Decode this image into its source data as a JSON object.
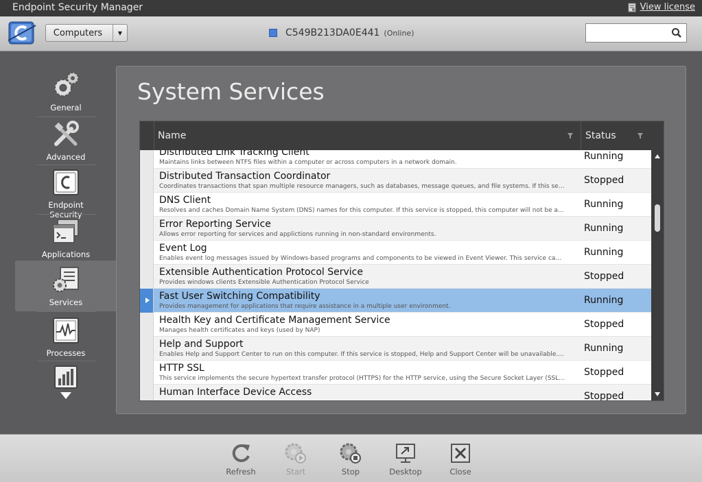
{
  "app": {
    "title": "Endpoint Security Manager",
    "license_link": "View license"
  },
  "toolbar": {
    "scope_dropdown": "Computers",
    "device_name": "C549B213DA0E441",
    "device_status": "(Online)",
    "search_placeholder": ""
  },
  "sidebar": {
    "items": [
      {
        "label": "General",
        "icon": "gears-icon"
      },
      {
        "label": "Advanced",
        "icon": "tools-icon"
      },
      {
        "label": "Endpoint Security",
        "icon": "endpoint-logo-icon"
      },
      {
        "label": "Applications",
        "icon": "applications-icon"
      },
      {
        "label": "Services",
        "icon": "services-icon",
        "selected": true
      },
      {
        "label": "Processes",
        "icon": "processes-icon"
      },
      {
        "label": "",
        "icon": "performance-icon"
      }
    ]
  },
  "main": {
    "title": "System Services",
    "columns": {
      "name": "Name",
      "status": "Status"
    },
    "rows": [
      {
        "name": "Distributed Link Tracking Client",
        "desc": "Maintains links between NTFS files within a computer or across computers in a network domain.",
        "status": "Running"
      },
      {
        "name": "Distributed Transaction Coordinator",
        "desc": "Coordinates transactions that span multiple resource managers, such as databases, message queues, and file systems. If this service is...",
        "status": "Stopped"
      },
      {
        "name": "DNS Client",
        "desc": "Resolves and caches Domain Name System (DNS) names for this computer. If this service is stopped, this computer will not be able to...",
        "status": "Running"
      },
      {
        "name": "Error Reporting Service",
        "desc": "Allows error reporting for services and applictions running in non-standard environments.",
        "status": "Running"
      },
      {
        "name": "Event Log",
        "desc": "Enables event log messages issued by Windows-based programs and components to be viewed in Event Viewer. This service cannot be...",
        "status": "Running"
      },
      {
        "name": "Extensible Authentication Protocol Service",
        "desc": "Provides windows clients Extensible Authentication Protocol Service",
        "status": "Stopped"
      },
      {
        "name": "Fast User Switching Compatibility",
        "desc": "Provides management for applications that require assistance in a multiple user environment.",
        "status": "Running",
        "selected": true
      },
      {
        "name": "Health Key and Certificate Management Service",
        "desc": "Manages health certificates and keys (used by NAP)",
        "status": "Stopped"
      },
      {
        "name": "Help and Support",
        "desc": "Enables Help and Support Center to run on this computer. If this service is stopped, Help and Support Center will be unavailable. If this...",
        "status": "Running"
      },
      {
        "name": "HTTP SSL",
        "desc": "This service implements the secure hypertext transfer protocol (HTTPS) for the HTTP service,  using the Secure Socket Layer (SSL). If this...",
        "status": "Stopped"
      },
      {
        "name": "Human Interface Device Access",
        "desc": "",
        "status": "Stopped"
      }
    ]
  },
  "actions": {
    "refresh": "Refresh",
    "start": "Start",
    "stop": "Stop",
    "desktop": "Desktop",
    "close": "Close"
  },
  "colors": {
    "selection": "#94bde7",
    "accent": "#4a8ad6",
    "panel": "#707072",
    "background": "#5b5b5d"
  }
}
